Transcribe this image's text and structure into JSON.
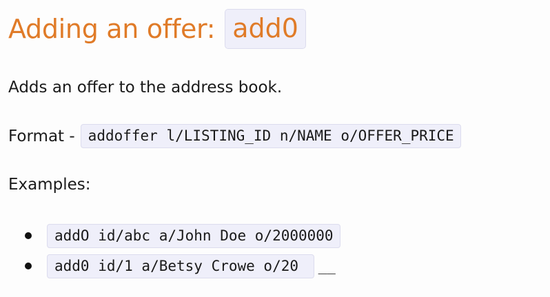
{
  "heading": {
    "text": "Adding an offer:",
    "command": "add0"
  },
  "description": "Adds an offer to the address book.",
  "format": {
    "label": "Format -",
    "code": "addoffer l/LISTING_ID n/NAME o/OFFER_PRICE"
  },
  "examples": {
    "label": "Examples:",
    "items": [
      {
        "code": "addO id/abc a/John Doe o/2000000",
        "trail": ""
      },
      {
        "code": "add0 id/1 a/Betsy Crowe o/20 ",
        "trail": "__"
      }
    ]
  },
  "colors": {
    "heading": "#e07b28",
    "code_background": "#efeffa",
    "text": "#1a1a1a"
  }
}
